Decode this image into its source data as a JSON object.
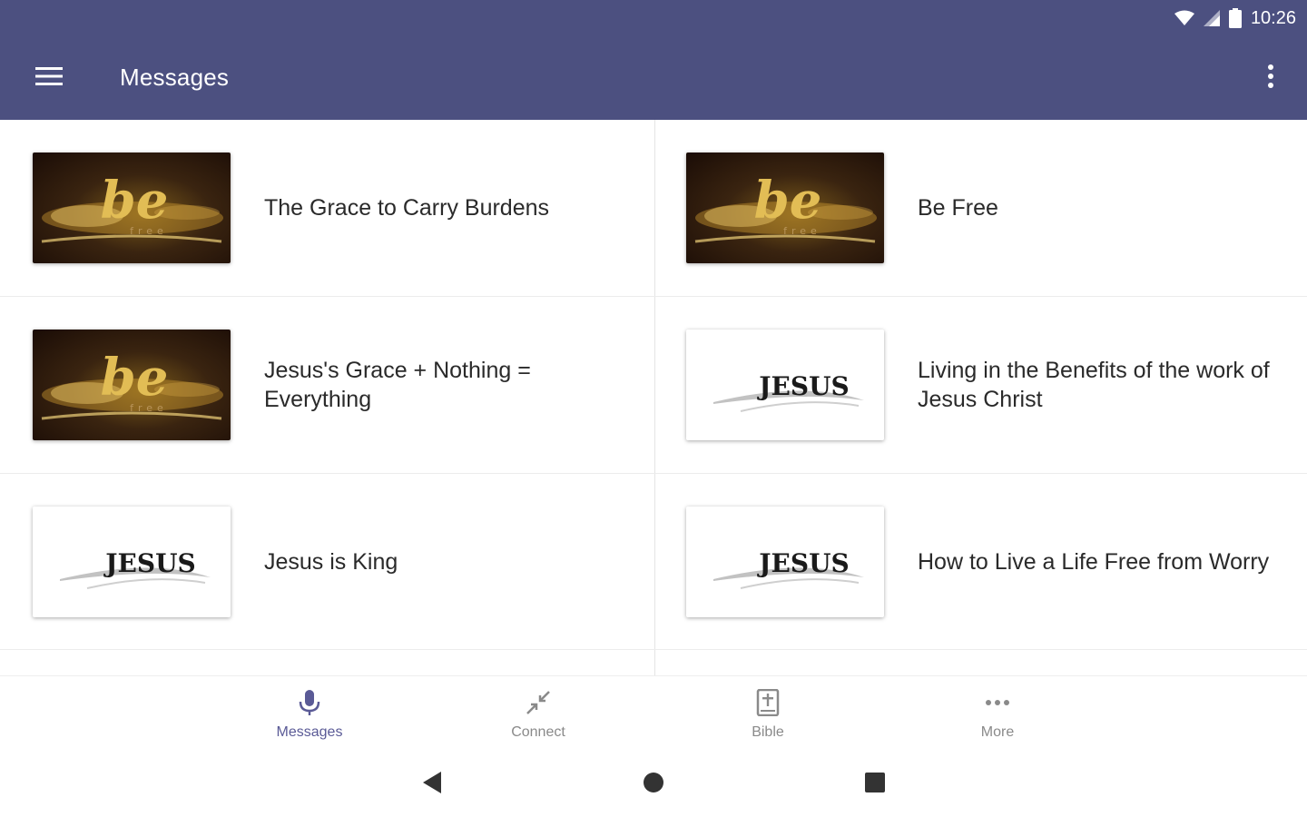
{
  "status_bar": {
    "time": "10:26"
  },
  "app_bar": {
    "title": "Messages",
    "background": "#4c5080"
  },
  "messages": [
    {
      "title": "The Grace to Carry Burdens",
      "thumbnail": "be-free-artwork",
      "thumb_text": "be",
      "thumb_sub": "free"
    },
    {
      "title": "Be Free",
      "thumbnail": "be-free-artwork",
      "thumb_text": "be",
      "thumb_sub": "free"
    },
    {
      "title": "Jesus's Grace + Nothing = Everything",
      "thumbnail": "be-free-artwork",
      "thumb_text": "be",
      "thumb_sub": "free"
    },
    {
      "title": "Living in the Benefits of the work of Jesus Christ",
      "thumbnail": "jesus-artwork",
      "thumb_text": "JESUS"
    },
    {
      "title": "Jesus is King",
      "thumbnail": "jesus-artwork",
      "thumb_text": "JESUS"
    },
    {
      "title": "How to Live a Life Free from Worry",
      "thumbnail": "jesus-artwork",
      "thumb_text": "JESUS"
    }
  ],
  "bottom_nav": [
    {
      "label": "Messages",
      "icon": "microphone-icon",
      "active": true
    },
    {
      "label": "Connect",
      "icon": "connect-icon",
      "active": false
    },
    {
      "label": "Bible",
      "icon": "bible-icon",
      "active": false
    },
    {
      "label": "More",
      "icon": "more-horizontal-icon",
      "active": false
    }
  ],
  "colors": {
    "active_nav": "#5a5a96",
    "inactive_nav": "#8a8a8a"
  }
}
